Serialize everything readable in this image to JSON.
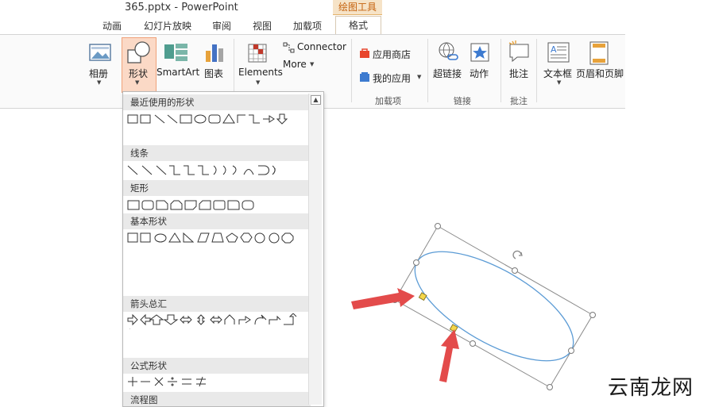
{
  "window": {
    "title": "365.pptx - PowerPoint",
    "context_group": "绘图工具"
  },
  "tabs": [
    "动画",
    "幻灯片放映",
    "审阅",
    "视图",
    "加载项",
    "格式"
  ],
  "ribbon": {
    "album": "相册",
    "shapes": "形状",
    "smartart": "SmartArt",
    "chart": "图表",
    "elements": "Elements",
    "connector": "Connector",
    "more": "More",
    "app_store": "应用商店",
    "my_apps": "我的应用",
    "addins_group": "加载项",
    "hyperlink": "超链接",
    "action": "动作",
    "links_group": "链接",
    "comment": "批注",
    "comments_group": "批注",
    "textbox": "文本框",
    "header_footer": "页眉和页脚"
  },
  "gallery": {
    "categories": [
      "最近使用的形状",
      "线条",
      "矩形",
      "基本形状",
      "箭头总汇",
      "公式形状",
      "流程图"
    ],
    "scroll_up_glyph": "▲"
  },
  "watermark": "云南龙网",
  "colors": {
    "accent": "#c5620e",
    "tab_highlight": "#f6e3c7",
    "ellipse": "#5b9bd5",
    "arrow": "#e34b4b",
    "handle": "#f5d74a"
  }
}
